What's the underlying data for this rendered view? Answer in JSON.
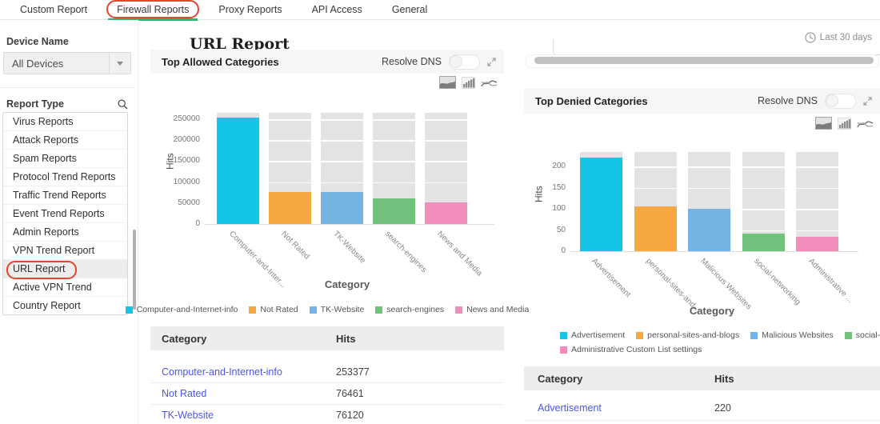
{
  "nav": {
    "tabs": [
      {
        "label": "Custom Report"
      },
      {
        "label": "Firewall Reports",
        "active": true,
        "annotated": true
      },
      {
        "label": "Proxy Reports"
      },
      {
        "label": "API Access"
      },
      {
        "label": "General"
      }
    ]
  },
  "sidebar": {
    "device_name_label": "Device Name",
    "device_select": {
      "value": "All Devices"
    },
    "report_type_label": "Report Type",
    "report_types": [
      {
        "label": "Virus Reports"
      },
      {
        "label": "Attack Reports"
      },
      {
        "label": "Spam Reports"
      },
      {
        "label": "Protocol Trend Reports"
      },
      {
        "label": "Traffic Trend Reports"
      },
      {
        "label": "Event Trend Reports"
      },
      {
        "label": "Admin Reports"
      },
      {
        "label": "VPN Trend Report"
      },
      {
        "label": "URL Report",
        "selected": true,
        "annotated": true
      },
      {
        "label": "Active VPN Trend"
      },
      {
        "label": "Country Report"
      }
    ]
  },
  "header": {
    "title": "URL Report",
    "time_range": "Last 30 days"
  },
  "panels": [
    {
      "title": "Top Allowed Categories",
      "resolve_dns_label": "Resolve DNS",
      "toggle_state": "off"
    },
    {
      "title": "Top Denied Categories",
      "resolve_dns_label": "Resolve DNS",
      "toggle_state": "off"
    }
  ],
  "chart_data": [
    {
      "type": "bar",
      "title": "Top Allowed Categories",
      "xlabel": "Category",
      "ylabel": "Hits",
      "categories": [
        "Computer-and-Internet-info",
        "Not Rated",
        "TK-Website",
        "search-engines",
        "News and Media"
      ],
      "x_tick_labels": [
        "Computer-and-Inter...",
        "Not Rated",
        "TK-Website",
        "search-engines",
        "News and Media"
      ],
      "values": [
        253377,
        76461,
        76120,
        61000,
        51500
      ],
      "colors": [
        "#15c5e8",
        "#f7a843",
        "#75b3e3",
        "#72c17c",
        "#f28cba"
      ],
      "yticks": [
        0,
        50000,
        100000,
        150000,
        200000,
        250000
      ],
      "ylim": [
        0,
        262000
      ],
      "grid": true,
      "track_color": "#e3e3e3",
      "legend": [
        "Computer-and-Internet-info",
        "Not Rated",
        "TK-Website",
        "search-engines",
        "News and Media"
      ],
      "legend_position": "bottom-center"
    },
    {
      "type": "bar",
      "title": "Top Denied Categories",
      "xlabel": "Category",
      "ylabel": "Hits",
      "categories": [
        "Advertisement",
        "personal-sites-and-blogs",
        "Malicious Websites",
        "social-networking",
        "Administrative Custom List settings"
      ],
      "x_tick_labels": [
        "Advertisement",
        "personal-sites-and-...",
        "Malicious Websites",
        "social-networking",
        "Administrative ..."
      ],
      "values": [
        220,
        105,
        100,
        42,
        34
      ],
      "colors": [
        "#15c5e8",
        "#f7a843",
        "#75b3e3",
        "#72c17c",
        "#f28cba"
      ],
      "yticks": [
        0,
        50,
        100,
        150,
        200
      ],
      "ylim": [
        0,
        235
      ],
      "grid": true,
      "track_color": "#e3e3e3",
      "legend": [
        "Advertisement",
        "personal-sites-and-blogs",
        "Malicious Websites",
        "social-networking",
        "Administrative Custom List settings"
      ],
      "legend_position": "bottom-left"
    }
  ],
  "tables": [
    {
      "columns": [
        "Category",
        "Hits"
      ],
      "rows": [
        [
          "Computer-and-Internet-info",
          "253377"
        ],
        [
          "Not Rated",
          "76461"
        ],
        [
          "TK-Website",
          "76120"
        ]
      ]
    },
    {
      "columns": [
        "Category",
        "Hits"
      ],
      "rows": [
        [
          "Advertisement",
          "220"
        ]
      ]
    }
  ],
  "icons": {
    "time": "clock-icon",
    "search": "search-icon",
    "select_caret": "chevron-down-icon",
    "panel_expand": "expand-icon",
    "chart_types": [
      "area-chart-icon",
      "bar-chart-icon",
      "line-chart-icon"
    ]
  },
  "colors": {
    "annotation": "#e8432d",
    "active_tab_underline": "#2bb673",
    "link": "#4c56f0",
    "panel_header_bg": "#f6f6f6",
    "table_header_bg": "#ededed"
  }
}
